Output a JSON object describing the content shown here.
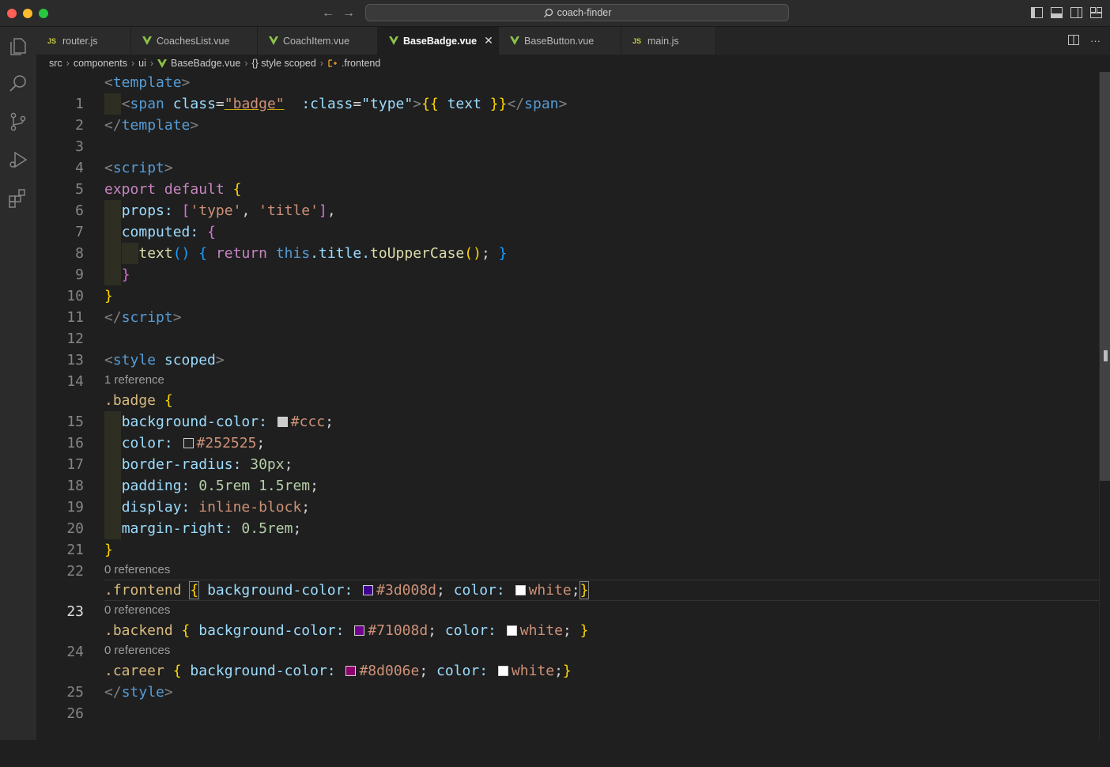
{
  "window": {
    "search_label": "coach-finder",
    "traffic_lights": [
      "#ff5f57",
      "#febc2e",
      "#28c840"
    ]
  },
  "activity_bar": [
    "explorer-icon",
    "search-icon",
    "source-control-icon",
    "run-debug-icon",
    "extensions-icon"
  ],
  "tabs": [
    {
      "label": "router.js",
      "icon": "js"
    },
    {
      "label": "CoachesList.vue",
      "icon": "vue"
    },
    {
      "label": "CoachItem.vue",
      "icon": "vue"
    },
    {
      "label": "BaseBadge.vue",
      "icon": "vue"
    },
    {
      "label": "BaseButton.vue",
      "icon": "vue"
    },
    {
      "label": "main.js",
      "icon": "js"
    }
  ],
  "active_tab": "BaseBadge.vue",
  "icon_labels": {
    "js": "JS"
  },
  "breadcrumb": {
    "seg1": "src",
    "seg2": "components",
    "seg3": "ui",
    "seg4": "BaseBadge.vue",
    "seg5": "{} style scoped",
    "seg6": ".frontend"
  },
  "lines": {
    "l1": "1",
    "l2": "2",
    "l3": "3",
    "l4": "4",
    "l5": "5",
    "l6": "6",
    "l7": "7",
    "l8": "8",
    "l9": "9",
    "l10": "10",
    "l11": "11",
    "l12": "12",
    "l13": "13",
    "l14": "14",
    "l15": "15",
    "l16": "16",
    "l17": "17",
    "l18": "18",
    "l19": "19",
    "l20": "20",
    "l21": "21",
    "l22": "22",
    "l23": "23",
    "l24": "24",
    "l25": "25",
    "l26": "26"
  },
  "code": {
    "template_tag": "template",
    "span_tag": "span",
    "class_attr": "class",
    "badge_val": "\"badge\"",
    "bind_class_attr": ":class",
    "type_val": "\"type\"",
    "mustache_open": "{{",
    "text_expr": " text ",
    "mustache_close": "}}",
    "script_tag": "script",
    "export_kw": "export default",
    "props_key": "props:",
    "type_str": "'type'",
    "title_str": "'title'",
    "computed_key": "computed:",
    "text_fn": "text",
    "return_kw": "return",
    "this_kw": "this",
    "title_prop": ".title.",
    "upper_fn": "toUpperCase",
    "style_tag": "style",
    "scoped_attr": "scoped",
    "badge_sel": ".badge",
    "bg_prop": "background-color:",
    "ccc_val": "#ccc",
    "color_prop": "color:",
    "c252525_val": "#252525",
    "radius_prop": "border-radius:",
    "radius_val": "30px",
    "padding_prop": "padding:",
    "padding_val": "0.5rem 1.5rem",
    "display_prop": "display:",
    "display_val": "inline-block",
    "margin_prop": "margin-right:",
    "margin_val": "0.5rem",
    "frontend_sel": ".frontend",
    "c3d008d_val": "#3d008d",
    "white_val": "white",
    "backend_sel": ".backend",
    "c71008d_val": "#71008d",
    "career_sel": ".career",
    "c8d006e_val": "#8d006e"
  },
  "codelens": {
    "badge": "1 reference",
    "frontend": "0 references",
    "backend": "0 references",
    "career": "0 references"
  },
  "swatch_colors": {
    "ccc": "#cccccc",
    "c252525": "#252525",
    "c3d008d": "#3d008d",
    "white": "#ffffff",
    "c71008d": "#71008d",
    "c8d006e": "#8d006e"
  },
  "syntax_colors": {
    "tag": "#569cd6",
    "attribute": "#9cdcfe",
    "string": "#ce9178",
    "keyword": "#c586c0",
    "function": "#dcdcaa",
    "number": "#b5cea8",
    "selector": "#d7ba7d",
    "bracket_1": "#ffd700",
    "bracket_2": "#da70d6",
    "bracket_3": "#179fff"
  }
}
